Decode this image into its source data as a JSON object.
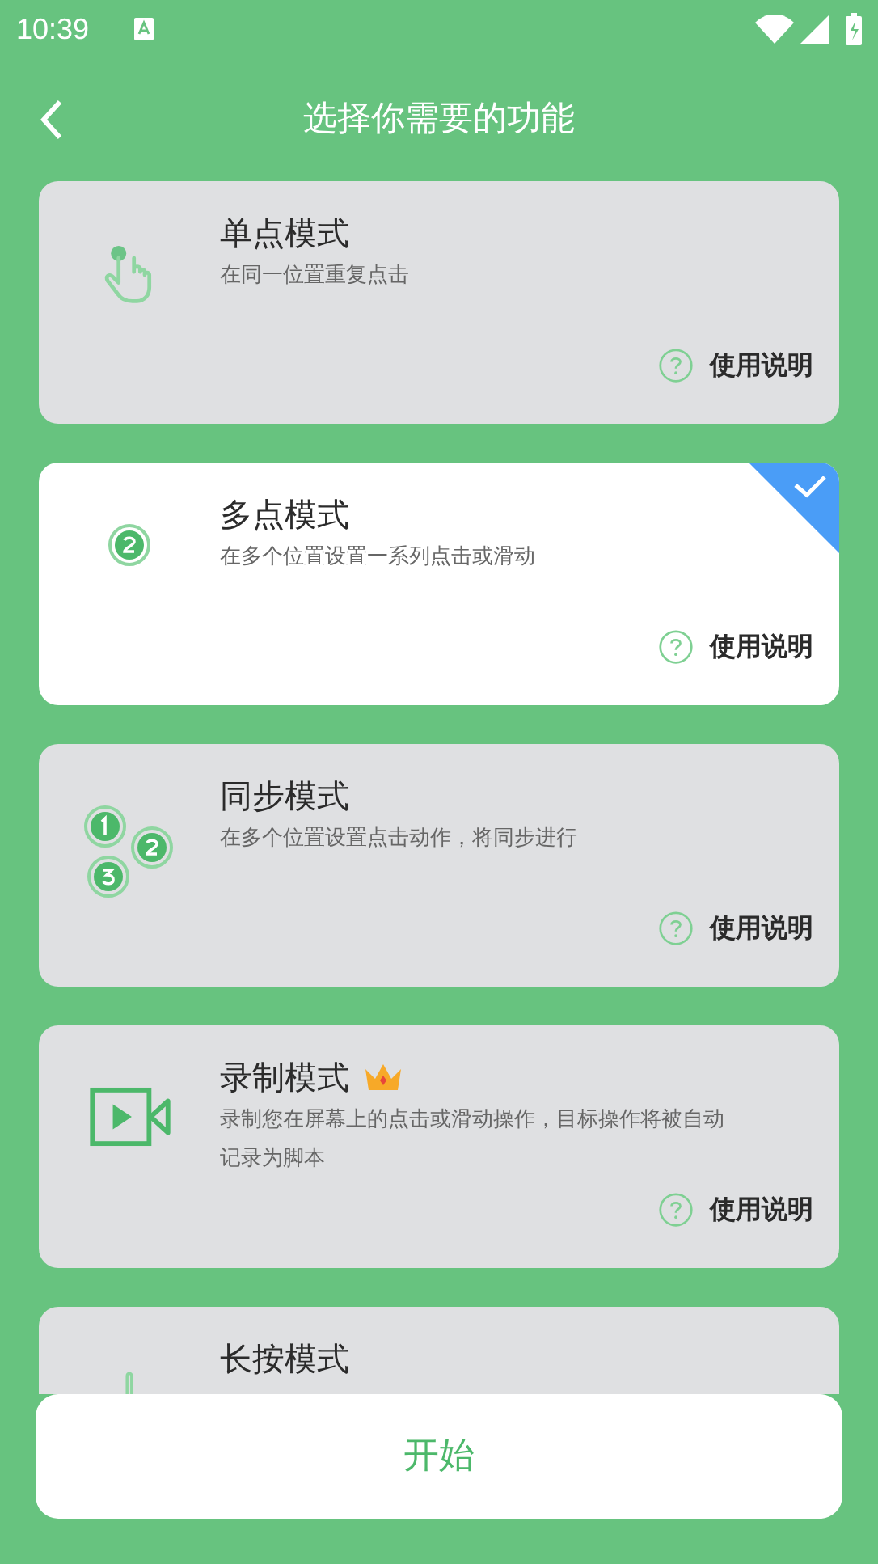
{
  "status_bar": {
    "time": "10:39"
  },
  "header": {
    "title": "选择你需要的功能"
  },
  "modes": [
    {
      "kind": "tap",
      "title": "单点模式",
      "description": "在同一位置重复点击",
      "help": "使用说明",
      "selected": false,
      "premium": false
    },
    {
      "kind": "multi",
      "title": "多点模式",
      "description": "在多个位置设置一系列点击或滑动",
      "help": "使用说明",
      "selected": true,
      "premium": false
    },
    {
      "kind": "sync",
      "title": "同步模式",
      "description": "在多个位置设置点击动作，将同步进行",
      "help": "使用说明",
      "selected": false,
      "premium": false
    },
    {
      "kind": "record",
      "title": "录制模式",
      "description": "录制您在屏幕上的点击或滑动操作，目标操作将被自动记录为脚本",
      "help": "使用说明",
      "selected": false,
      "premium": true
    },
    {
      "kind": "press",
      "title": "长按模式",
      "selected": false,
      "premium": false
    }
  ],
  "start_button": "开始"
}
